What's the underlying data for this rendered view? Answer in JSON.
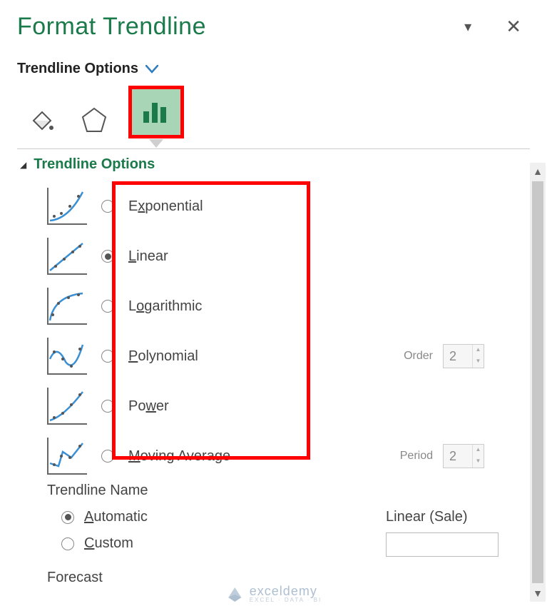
{
  "pane": {
    "title": "Format Trendline",
    "dropdown_label": "Trendline Options"
  },
  "section": {
    "title": "Trendline Options"
  },
  "options": {
    "exponential": "Exponential",
    "linear": "Linear",
    "logarithmic": "Logarithmic",
    "polynomial": "Polynomial",
    "power": "Power",
    "moving_average": "Moving Average"
  },
  "side": {
    "order_label": "Order",
    "order_value": "2",
    "period_label": "Period",
    "period_value": "2"
  },
  "name": {
    "section_label": "Trendline Name",
    "automatic": "Automatic",
    "custom": "Custom",
    "auto_value": "Linear (Sale)"
  },
  "forecast": {
    "label": "Forecast"
  },
  "watermark": {
    "brand": "exceldemy",
    "sub": "EXCEL · DATA · BI"
  }
}
